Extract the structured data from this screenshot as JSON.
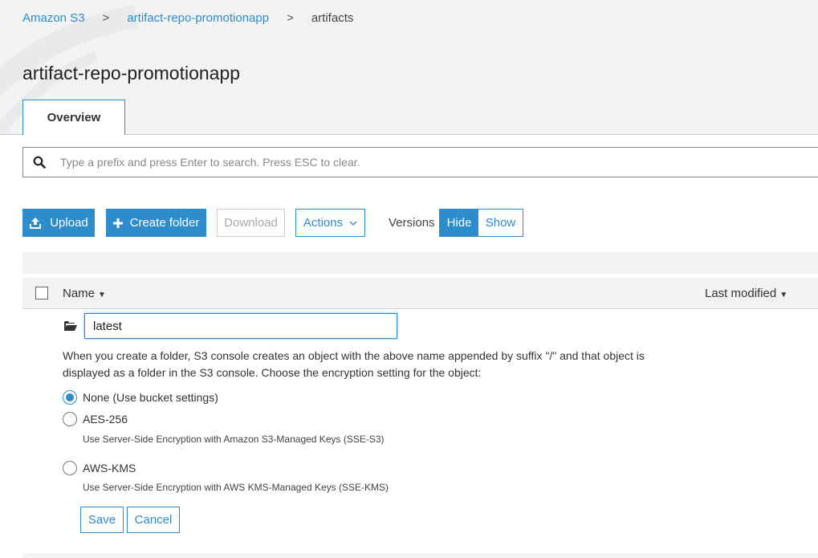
{
  "breadcrumb": {
    "root": "Amazon S3",
    "bucket": "artifact-repo-promotionapp",
    "current": "artifacts",
    "separator": ">"
  },
  "page": {
    "title": "artifact-repo-promotionapp"
  },
  "tabs": [
    {
      "label": "Overview",
      "selected": true
    }
  ],
  "search": {
    "placeholder": "Type a prefix and press Enter to search. Press ESC to clear.",
    "value": ""
  },
  "toolbar": {
    "upload_label": "Upload",
    "create_folder_label": "Create folder",
    "download_label": "Download",
    "actions_label": "Actions",
    "versions_label": "Versions",
    "hide_label": "Hide",
    "show_label": "Show"
  },
  "table": {
    "columns": {
      "name": "Name",
      "last_modified": "Last modified"
    }
  },
  "new_folder": {
    "name_value": "latest",
    "description": "When you create a folder, S3 console creates an object with the above name appended by suffix \"/\" and that object is displayed as a folder in the S3 console. Choose the encryption setting for the object:",
    "options": [
      {
        "label": "None (Use bucket settings)",
        "hint": "",
        "selected": true
      },
      {
        "label": "AES-256",
        "hint": "Use Server-Side Encryption with Amazon S3-Managed Keys (SSE-S3)",
        "selected": false
      },
      {
        "label": "AWS-KMS",
        "hint": "Use Server-Side Encryption with AWS KMS-Managed Keys (SSE-KMS)",
        "selected": false
      }
    ],
    "save_label": "Save",
    "cancel_label": "Cancel"
  },
  "colors": {
    "accent": "#2d8ccc",
    "background": "#f2f3f3"
  },
  "icons": [
    "search-icon",
    "upload-icon",
    "plus-icon",
    "chevron-down-icon",
    "caret-down-icon",
    "folder-open-icon"
  ]
}
